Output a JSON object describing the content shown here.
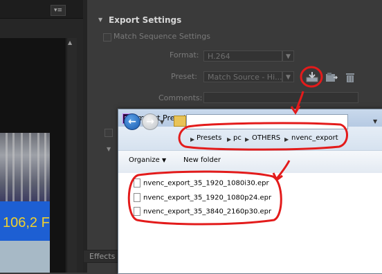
{
  "left_panel": {
    "video_text": "106,2 F"
  },
  "export": {
    "title": "Export Settings",
    "match_sequence": "Match Sequence Settings",
    "format_label": "Format:",
    "format_value": "H.264",
    "preset_label": "Preset:",
    "preset_value": "Match Source - Hi...",
    "comments_label": "Comments:",
    "effects_tab": "Effects"
  },
  "dialog": {
    "app_icon": "Pr",
    "title": "Import Preset",
    "breadcrumbs": [
      "Presets",
      "pc",
      "OTHERS",
      "nvenc_export"
    ],
    "organize": "Organize",
    "new_folder": "New folder",
    "files": [
      "nvenc_export_35_1920_1080i30.epr",
      "nvenc_export_35_1920_1080p24.epr",
      "nvenc_export_35_3840_2160p30.epr"
    ]
  },
  "colors": {
    "annotation": "#e31b1b",
    "panel_bg": "#3a3a3a",
    "dialog_title_bg": "#c9d9ec"
  },
  "icons": {
    "import_preset": "import-preset-icon",
    "save_preset": "save-preset-icon",
    "delete_preset": "trash-icon"
  }
}
